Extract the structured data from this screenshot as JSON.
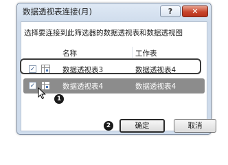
{
  "dialog": {
    "title": "数据透视表连接(月)",
    "help_label": "?",
    "close_label": "✕",
    "prompt": "选择要连接到此筛选器的数据透视表和数据透视图",
    "columns": [
      "名称",
      "工作表"
    ],
    "rows": [
      {
        "checked": true,
        "checkmark": "✓",
        "name": "数据透视表3",
        "sheet": "数据透视表4"
      },
      {
        "checked": true,
        "checkmark": "✓",
        "name": "数据透视表4",
        "sheet": "数据透视表4"
      }
    ],
    "ok_label": "确定",
    "cancel_label": "取消"
  },
  "annotations": {
    "marker_1": "1",
    "marker_2": "2"
  },
  "colors": {
    "selected_row": "#8c8c8c",
    "close_button": "#c8452c"
  },
  "icons": {
    "row_icon": "pivot-table-icon",
    "pointer": "mouse-pointer-icon"
  }
}
